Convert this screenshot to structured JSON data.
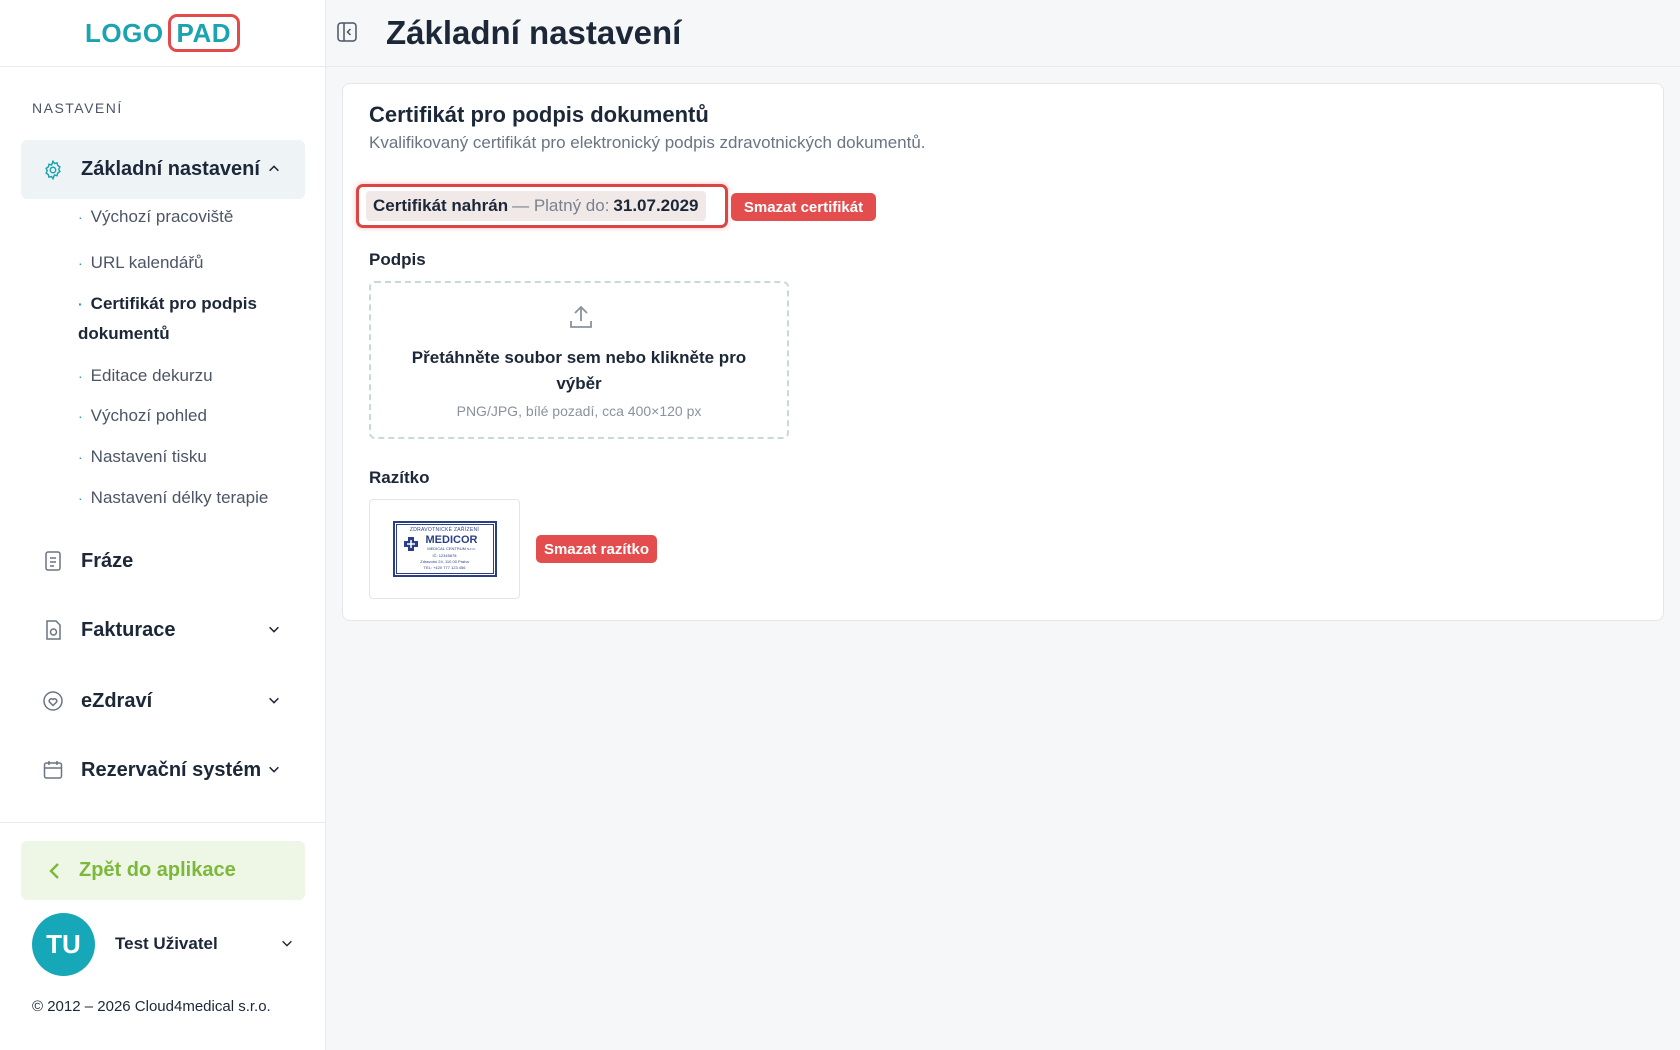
{
  "logo": {
    "part1": "LOGO",
    "part2": "PAD"
  },
  "sidebar": {
    "section_label": "NASTAVENÍ",
    "active_item": "Základní nastavení",
    "sub_items": [
      "Výchozí pracoviště",
      "URL kalendářů",
      "Certifikát pro podpis dokumentů",
      "Editace dekurzu",
      "Výchozí pohled",
      "Nastavení tisku",
      "Nastavení délky terapie"
    ],
    "items": [
      "Fráze",
      "Fakturace",
      "eZdraví",
      "Rezervační systém"
    ],
    "back_label": "Zpět do aplikace",
    "user_initials": "TU",
    "user_name": "Test Uživatel",
    "copyright": "© 2012 – 2026 Cloud4medical s.r.o."
  },
  "header": {
    "title": "Základní nastavení"
  },
  "card": {
    "title": "Certifikát pro podpis dokumentů",
    "description": "Kvalifikovaný certifikát pro elektronický podpis zdravotnických dokumentů.",
    "cert_status": "Certifikát nahrán",
    "cert_separator": "— Platný do:",
    "cert_valid_until": "31.07.2029",
    "delete_cert_label": "Smazat certifikát",
    "signature_label": "Podpis",
    "dropzone_text": "Přetáhněte soubor sem nebo klikněte pro výběr",
    "dropzone_hint": "PNG/JPG, bílé pozadí, cca 400×120 px",
    "stamp_label": "Razítko",
    "delete_stamp_label": "Smazat razítko"
  },
  "stamp_image": {
    "top": "ZDRAVOTNICKÉ ZAŘÍZENÍ",
    "name": "MEDICOR",
    "sub": "MEDICAL CENTRUM s.r.o.",
    "line1": "IČ: 12345678",
    "line2": "Zdravotní 24, 110 00 Praha",
    "line3": "TEL: +420 777 123 456"
  },
  "colors": {
    "brand_teal": "#1aa3b0",
    "accent_red": "#e44d4d",
    "back_green": "#7cb83a"
  }
}
